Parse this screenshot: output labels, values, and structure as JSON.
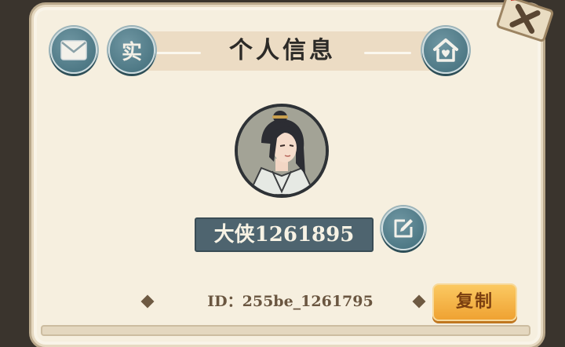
{
  "header": {
    "title": "个人信息",
    "real_name_label": "实"
  },
  "icons": {
    "mail": "envelope-icon",
    "real_name": "real-name-auth-icon",
    "home": "house-heart-icon",
    "edit": "edit-pencil-icon",
    "close": "close-x-icon"
  },
  "profile": {
    "nickname": "大侠1261895",
    "id_text": "ID：255be_1261795"
  },
  "actions": {
    "copy_label": "复制"
  },
  "colors": {
    "panel_bg": "#f6efdf",
    "button_teal": "#4f7c89",
    "copy_orange": "#f4b144",
    "name_box": "#4e646f"
  }
}
